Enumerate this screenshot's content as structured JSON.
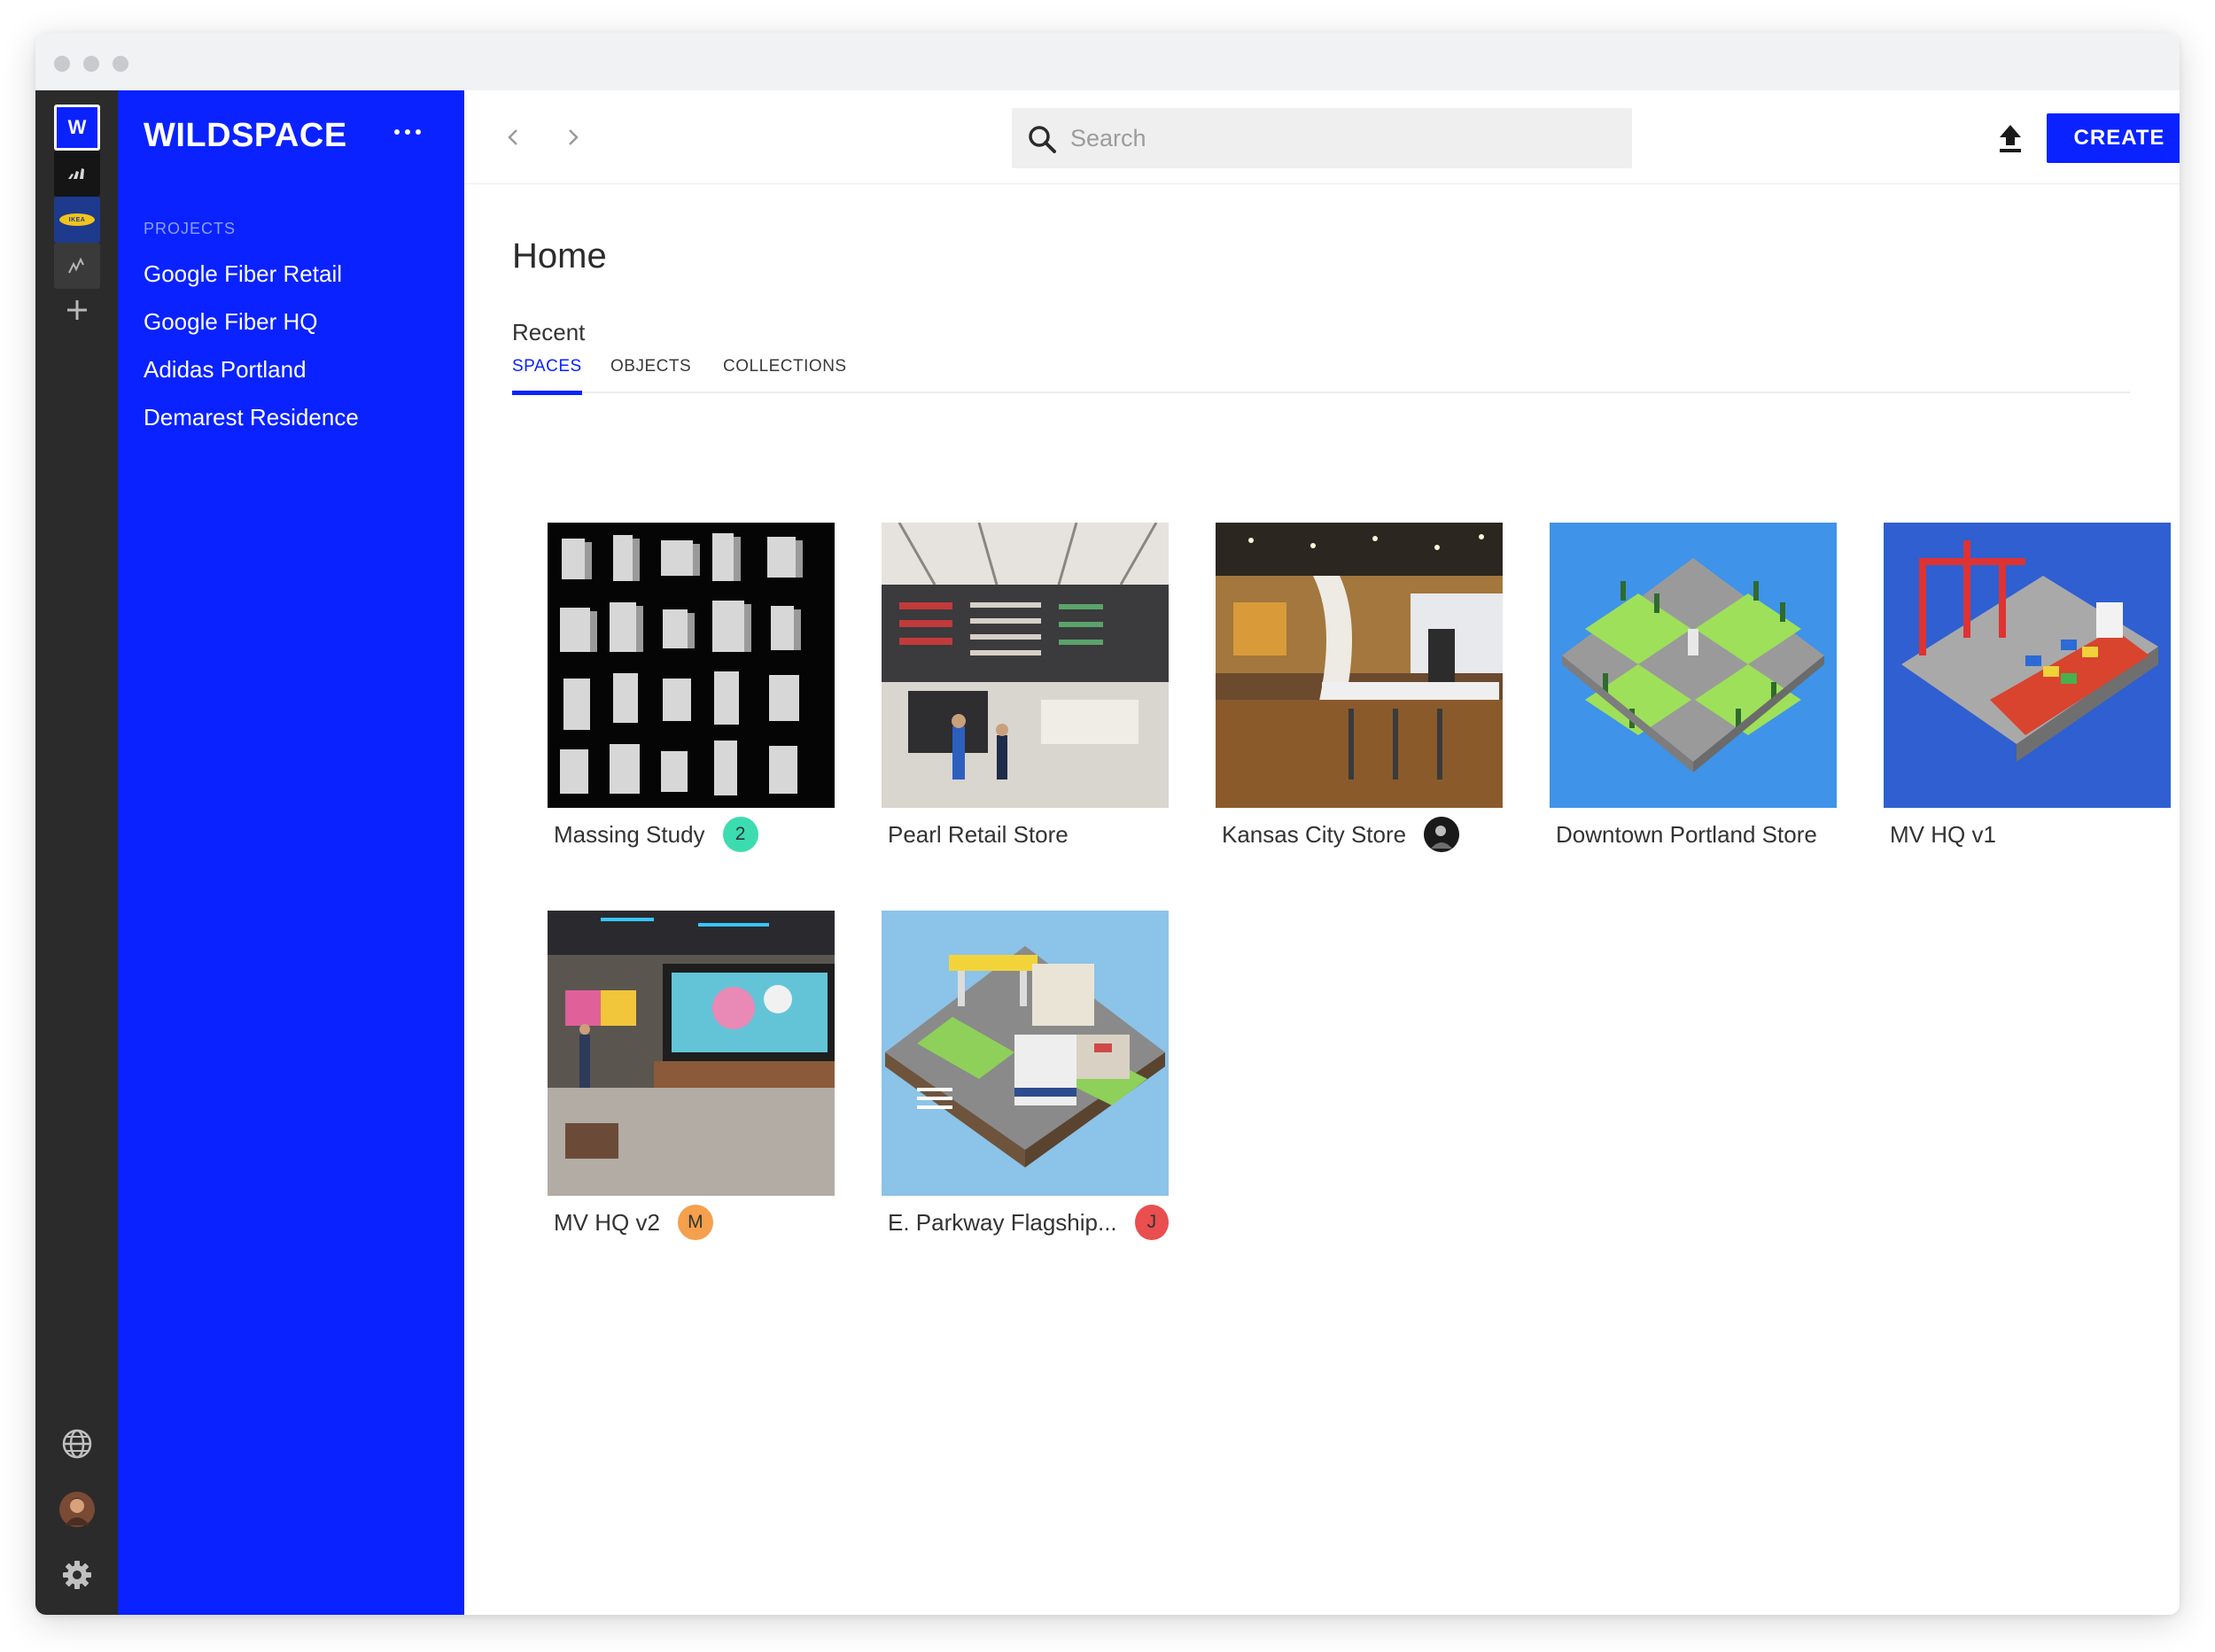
{
  "app": {
    "brand": "WILDSPACE",
    "logo_letter": "W"
  },
  "sidebar": {
    "projects_heading": "PROJECTS",
    "projects": [
      "Google Fiber Retail",
      "Google Fiber HQ",
      "Adidas Portland",
      "Demarest Residence"
    ]
  },
  "ikea_label": "IKEA",
  "search": {
    "placeholder": "Search"
  },
  "toolbar": {
    "create_label": "CREATE"
  },
  "page": {
    "title": "Home",
    "section": "Recent",
    "tabs": [
      "SPACES",
      "OBJECTS",
      "COLLECTIONS"
    ],
    "active_tab": "SPACES"
  },
  "cards": [
    {
      "name": "Massing Study",
      "badge": "2",
      "badge_color": "#3ddbb0"
    },
    {
      "name": "Pearl Retail Store"
    },
    {
      "name": "Kansas City Store",
      "avatar": "photo"
    },
    {
      "name": "Downtown Portland Store"
    },
    {
      "name": "MV HQ v1"
    },
    {
      "name": "MV HQ v2",
      "badge": "M",
      "badge_color": "#f4a04c"
    },
    {
      "name": "E. Parkway Flagship...",
      "badge": "J",
      "badge_color": "#ea4e4e"
    }
  ],
  "colors": {
    "brand_blue": "#0a22ff",
    "rail": "#2b2b2b"
  }
}
